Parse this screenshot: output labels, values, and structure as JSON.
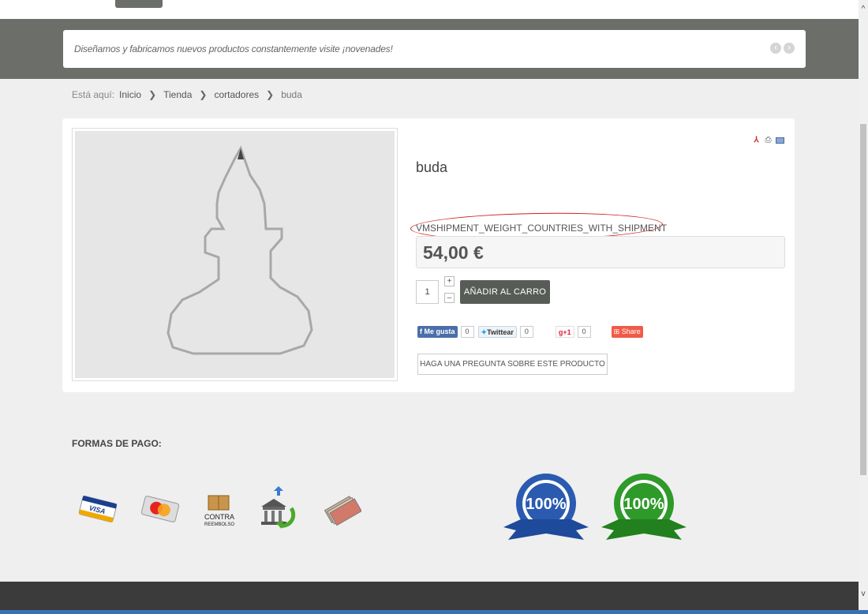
{
  "banner": {
    "ticker_text": "Diseñamos y fabricamos nuevos productos constantemente visite ¡novenades!",
    "prev_icon": "‹",
    "next_icon": "›"
  },
  "breadcrumb": {
    "label": "Está aquí:",
    "items": [
      "Inicio",
      "Tienda",
      "cortadores"
    ],
    "current": "buda",
    "separator": "❯"
  },
  "product": {
    "name": "buda",
    "shipment_key": "VMSHIPMENT_WEIGHT_COUNTRIES_WITH_SHIPMENT",
    "price": "54,00 €",
    "quantity": "1",
    "plus_label": "+",
    "minus_label": "–",
    "add_to_cart": "AÑADIR AL CARRO",
    "ask_question": "HAGA UNA PREGUNTA SOBRE ESTE PRODUCTO"
  },
  "social": {
    "facebook_label": "Me gusta",
    "facebook_count": "0",
    "twitter_label": "Twittear",
    "twitter_count": "0",
    "gplus_label": "+1",
    "gplus_count": "0",
    "share_label": "Share"
  },
  "payment": {
    "title": "FORMAS DE PAGO:",
    "methods": [
      "visa-card-icon",
      "mastercard-icon",
      "cash-on-delivery-icon",
      "bank-transfer-icon",
      "cash-icon"
    ],
    "contra_text": "CONTRA",
    "reembolso_text": "REEMBOLSO",
    "seal_satisfaction_text": "100%",
    "seal_secure_text": "100%"
  },
  "colors": {
    "banner_bg": "#6b6e69",
    "cart_button": "#585c57",
    "annotation_red": "#d11f1f",
    "footer_bg": "#3b3b3b"
  }
}
